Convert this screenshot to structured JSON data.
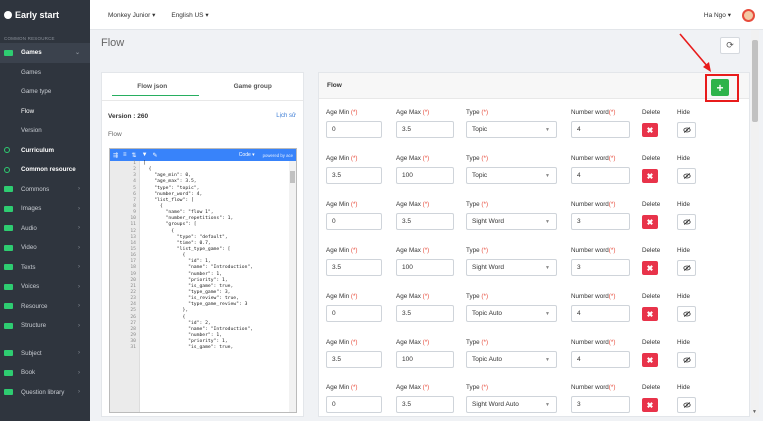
{
  "brand": "Early start",
  "sidebar": {
    "section": "common resource",
    "items": [
      {
        "label": "Games",
        "kind": "parent-active",
        "chevron": "⌄"
      },
      {
        "label": "Games",
        "kind": "sub"
      },
      {
        "label": "Game type",
        "kind": "sub"
      },
      {
        "label": "Flow",
        "kind": "sub-current"
      },
      {
        "label": "Version",
        "kind": "sub"
      },
      {
        "label": "Curriculum",
        "kind": "bold"
      },
      {
        "label": "Common resource",
        "kind": "bold"
      },
      {
        "label": "Commons",
        "kind": "item",
        "chevron": "›"
      },
      {
        "label": "Images",
        "kind": "item",
        "chevron": "›"
      },
      {
        "label": "Audio",
        "kind": "item",
        "chevron": "›"
      },
      {
        "label": "Video",
        "kind": "item",
        "chevron": "›"
      },
      {
        "label": "Texts",
        "kind": "item",
        "chevron": "›"
      },
      {
        "label": "Voices",
        "kind": "item",
        "chevron": "›"
      },
      {
        "label": "Resource",
        "kind": "item",
        "chevron": "›"
      },
      {
        "label": "Structure",
        "kind": "item",
        "chevron": "›"
      },
      {
        "label": "Subject",
        "kind": "item",
        "chevron": "›"
      },
      {
        "label": "Book",
        "kind": "item",
        "chevron": "›"
      },
      {
        "label": "Question library",
        "kind": "item",
        "chevron": "›"
      }
    ]
  },
  "topbar": {
    "product": "Monkey Junior",
    "language": "English US",
    "user": "Ha Ngo"
  },
  "page": {
    "title": "Flow"
  },
  "left_panel": {
    "tabs": [
      "Flow json",
      "Game group"
    ],
    "version": "Version : 260",
    "history": "Lịch sử",
    "flow_label": "Flow",
    "editor": {
      "mode": "Code",
      "powered": "powered by ace",
      "lines": [
        {
          "n": "1",
          "t": "["
        },
        {
          "n": "2",
          "t": "  {"
        },
        {
          "n": "3",
          "t": "    \"age_min\": 0,"
        },
        {
          "n": "4",
          "t": "    \"age_max\": 3.5,"
        },
        {
          "n": "5",
          "t": "    \"type\": \"topic\","
        },
        {
          "n": "6",
          "t": "    \"number_word\": 4,"
        },
        {
          "n": "7",
          "t": "    \"list_flow\": ["
        },
        {
          "n": "8",
          "t": "      {"
        },
        {
          "n": "9",
          "t": "        \"name\": \"flow 1\","
        },
        {
          "n": "10",
          "t": "        \"number_repetitions\": 1,"
        },
        {
          "n": "11",
          "t": "        \"groups\": ["
        },
        {
          "n": "12",
          "t": "          {"
        },
        {
          "n": "13",
          "t": "            \"type\": \"default\","
        },
        {
          "n": "14",
          "t": "            \"time\": 0.7,"
        },
        {
          "n": "15",
          "t": "            \"list_type_game\": ["
        },
        {
          "n": "16",
          "t": "              {"
        },
        {
          "n": "17",
          "t": "                \"id\": 1,"
        },
        {
          "n": "18",
          "t": "                \"name\": \"Introduction\","
        },
        {
          "n": "19",
          "t": "                \"number\": 1,"
        },
        {
          "n": "20",
          "t": "                \"priority\": 1,"
        },
        {
          "n": "21",
          "t": "                \"is_game\": true,"
        },
        {
          "n": "22",
          "t": "                \"type_game\": 3,"
        },
        {
          "n": "23",
          "t": "                \"is_review\": true,"
        },
        {
          "n": "24",
          "t": "                \"type_game_review\": 3"
        },
        {
          "n": "25",
          "t": "              },"
        },
        {
          "n": "26",
          "t": "              {"
        },
        {
          "n": "27",
          "t": "                \"id\": 2,"
        },
        {
          "n": "28",
          "t": "                \"name\": \"Introduction\","
        },
        {
          "n": "29",
          "t": "                \"number\": 1,"
        },
        {
          "n": "30",
          "t": "                \"priority\": 1,"
        },
        {
          "n": "31",
          "t": "                \"is_game\": true,"
        }
      ]
    }
  },
  "right_panel": {
    "title": "Flow",
    "labels": {
      "age_min": "Age Min",
      "age_max": "Age Max",
      "type": "Type",
      "number_word": "Number word",
      "required": "(*)",
      "delete": "Delete",
      "hide": "Hide"
    },
    "rows": [
      {
        "age_min": "0",
        "age_max": "3.5",
        "type": "Topic",
        "number_word": "4"
      },
      {
        "age_min": "3.5",
        "age_max": "100",
        "type": "Topic",
        "number_word": "4"
      },
      {
        "age_min": "0",
        "age_max": "3.5",
        "type": "Sight Word",
        "number_word": "3"
      },
      {
        "age_min": "3.5",
        "age_max": "100",
        "type": "Sight Word",
        "number_word": "3"
      },
      {
        "age_min": "0",
        "age_max": "3.5",
        "type": "Topic Auto",
        "number_word": "4"
      },
      {
        "age_min": "3.5",
        "age_max": "100",
        "type": "Topic Auto",
        "number_word": "4"
      },
      {
        "age_min": "0",
        "age_max": "3.5",
        "type": "Sight Word Auto",
        "number_word": "3"
      }
    ]
  },
  "icons": {
    "add": "+",
    "delete": "✖",
    "hide": "eye-slash-icon",
    "refresh": "⟳"
  },
  "colors": {
    "sidebar": "#2f353e",
    "accent_green": "#2db34a",
    "delete_red": "#e8334a",
    "highlight": "#e81b1b",
    "editor_blue": "#3883fa"
  }
}
